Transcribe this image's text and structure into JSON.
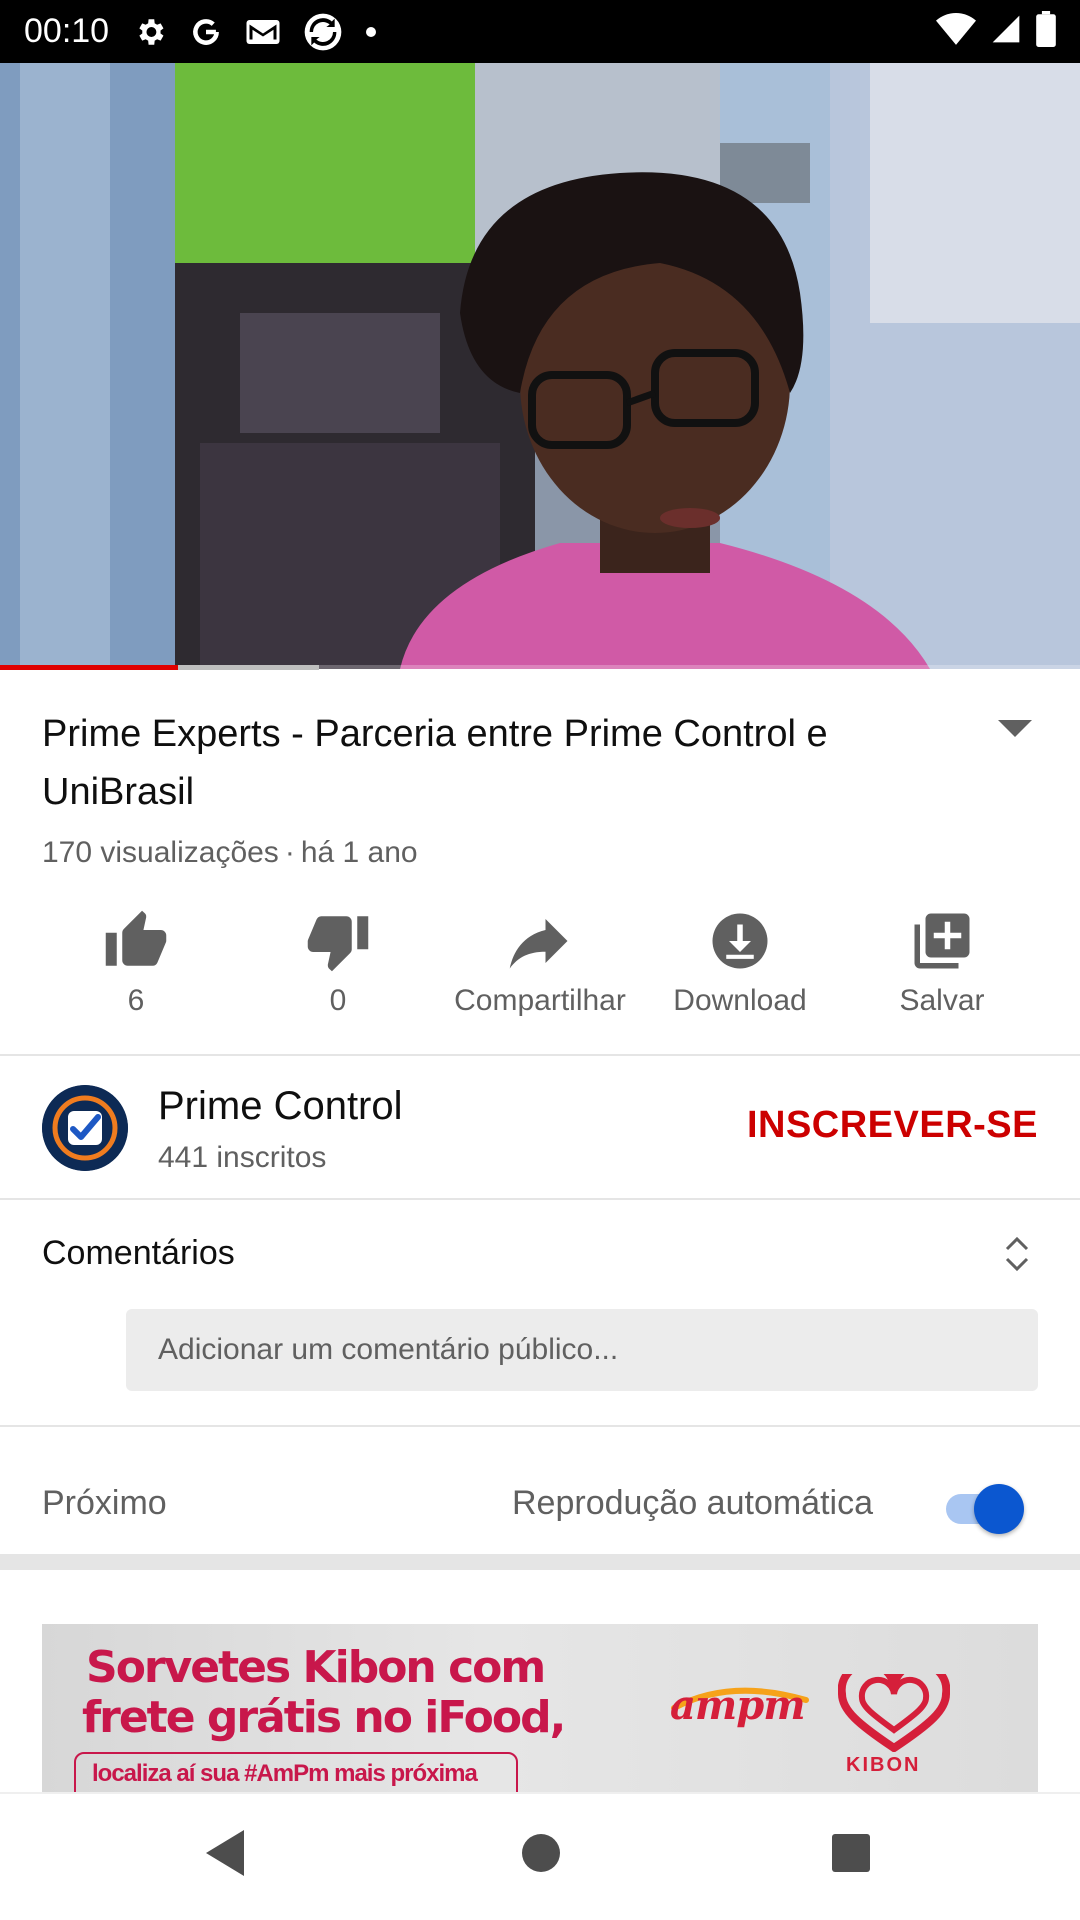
{
  "status_bar": {
    "time": "00:10",
    "left_icons": [
      "gear-icon",
      "google-g-icon",
      "gmail-icon",
      "sync-app-icon",
      "dot-icon"
    ],
    "right_icons": [
      "wifi-icon",
      "cellular-signal-icon",
      "battery-icon"
    ]
  },
  "video": {
    "played_fraction": 0.165,
    "buffered_fraction": 0.295
  },
  "details": {
    "title": "Prime Experts - Parceria entre Prime Control e UniBrasil",
    "views": "170 visualizações",
    "separator": "·",
    "age": "há 1 ano"
  },
  "actions": [
    {
      "icon": "thumbs-up-icon",
      "label": "6"
    },
    {
      "icon": "thumbs-down-icon",
      "label": "0"
    },
    {
      "icon": "share-icon",
      "label": "Compartilhar"
    },
    {
      "icon": "download-icon",
      "label": "Download"
    },
    {
      "icon": "add-to-playlist-icon",
      "label": "Salvar"
    }
  ],
  "channel": {
    "name": "Prime Control",
    "subscribers": "441 inscritos",
    "subscribe_label": "INSCREVER-SE"
  },
  "comments": {
    "title": "Comentários",
    "placeholder": "Adicionar um comentário público..."
  },
  "up_next": {
    "label": "Próximo",
    "autoplay_label": "Reprodução automática",
    "autoplay_on": true
  },
  "ad": {
    "headline_line1": "Sorvetes Kibon com",
    "headline_line2": "frete grátis no iFood,",
    "tagline": "localiza aí sua #AmPm mais próxima",
    "brand_ampm": "ampm",
    "brand_kibon": "KIBON"
  },
  "colors": {
    "accent_red": "#cc0000",
    "toggle_blue": "#0b57d0",
    "progress_red": "#e00000"
  }
}
